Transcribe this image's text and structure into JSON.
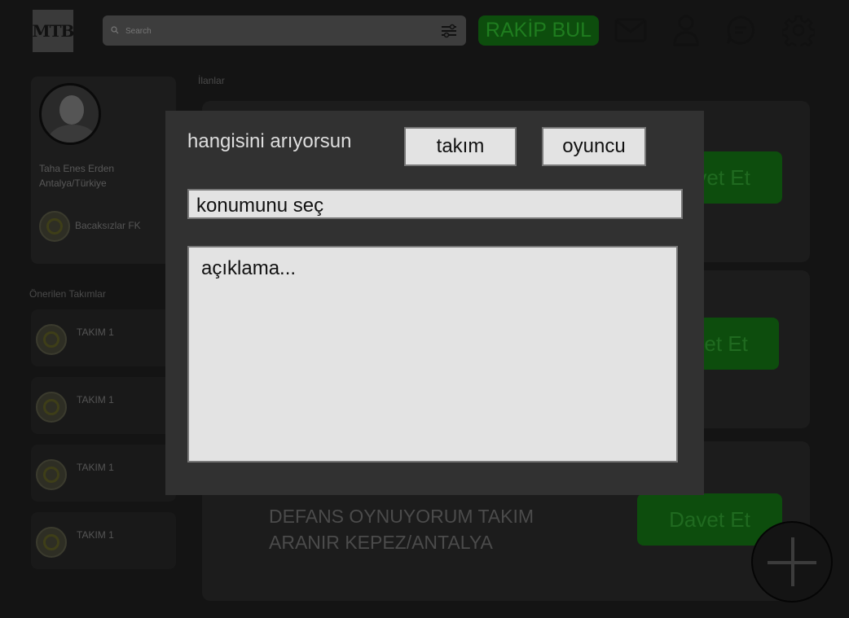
{
  "header": {
    "logo_text": "MTB",
    "search_placeholder": "Search",
    "cta_label": "RAKİP BUL",
    "icons": [
      "mail-icon",
      "user-icon",
      "chat-icon",
      "gear-icon"
    ]
  },
  "profile": {
    "name": "Taha Enes Erden",
    "location": "Antalya/Türkiye",
    "team": "Bacaksızlar FK"
  },
  "suggested": {
    "title": "Önerilen Takımlar",
    "teams": [
      "TAKIM 1",
      "TAKIM 1",
      "TAKIM 1",
      "TAKIM 1"
    ]
  },
  "feed": {
    "title": "İlanlar",
    "posts": [
      {
        "text": "",
        "button": "Davet Et"
      },
      {
        "text": "",
        "button": "Davet Et"
      },
      {
        "text_line1": "DEFANS OYNUYORUM TAKIM",
        "text_line2": "ARANIR KEPEZ/ANTALYA",
        "button": "Davet Et"
      }
    ]
  },
  "modal": {
    "question": "hangisini arıyorsun",
    "option_team": "takım",
    "option_player": "oyuncu",
    "location_placeholder": "konumunu seç",
    "description_placeholder": "açıklama..."
  },
  "colors": {
    "accent_green": "#0d4d0d",
    "overlay_bg": "#141414",
    "modal_bg": "#313131",
    "field_bg": "#e3e3e3"
  }
}
